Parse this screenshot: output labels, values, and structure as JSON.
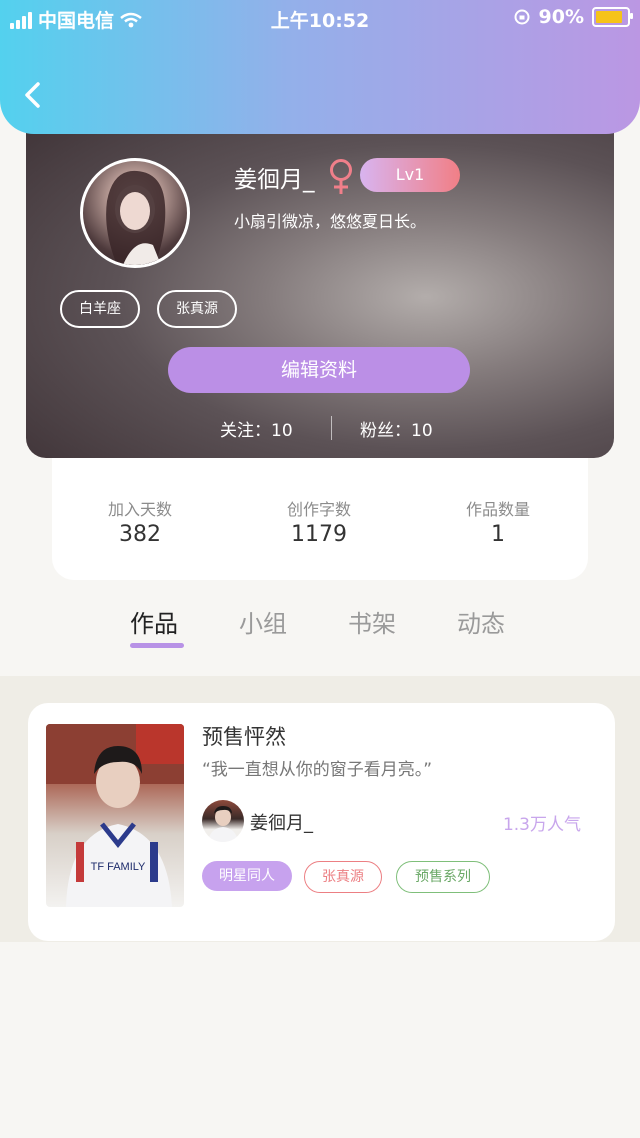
{
  "status_bar": {
    "carrier": "中国电信",
    "time": "上午10:52",
    "battery": "90%"
  },
  "profile": {
    "username": "姜徊月_",
    "gender_symbol": "♀",
    "level": "Lv1",
    "bio": "小扇引微凉，悠悠夏日长。",
    "tags": [
      "白羊座",
      "张真源"
    ],
    "edit_label": "编辑资料",
    "following": "关注：10",
    "followers": "粉丝：10"
  },
  "stats": [
    {
      "label": "加入天数",
      "value": "382"
    },
    {
      "label": "创作字数",
      "value": "1179"
    },
    {
      "label": "作品数量",
      "value": "1"
    }
  ],
  "tabs": [
    "作品",
    "小组",
    "书架",
    "动态"
  ],
  "active_tab": "作品",
  "work": {
    "title": "预售怦然",
    "quote": "“我一直想从你的窗子看月亮。”",
    "author": "姜徊月_",
    "popularity": "1.3万人气",
    "jersey_text": "TF FAMILY",
    "tags": [
      {
        "label": "明星同人",
        "style": "filled-purple"
      },
      {
        "label": "张真源",
        "style": "outline-red"
      },
      {
        "label": "预售系列",
        "style": "outline-green"
      }
    ]
  },
  "colors": {
    "accent": "#bb8fe6",
    "header_start": "#53d1ee",
    "header_end": "#bb97e3"
  }
}
